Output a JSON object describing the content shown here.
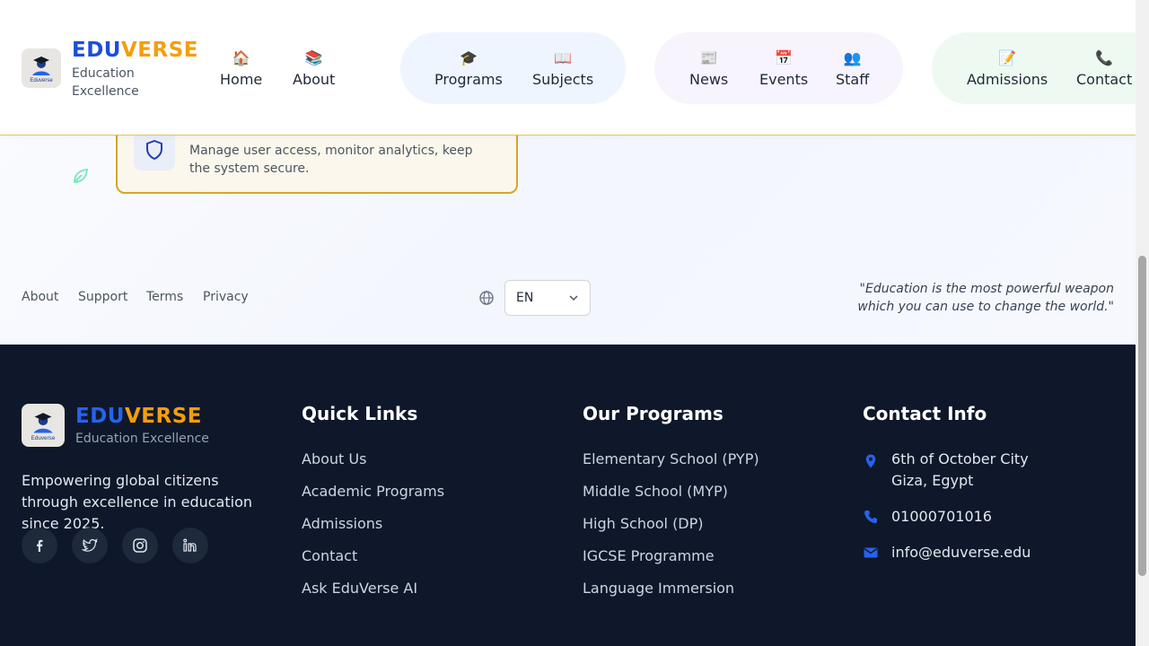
{
  "header": {
    "brand_part1": "EDU",
    "brand_part2": "VERSE",
    "logo_text": "Eduverse",
    "tagline": "Education Excellence",
    "nav": [
      {
        "icon": "🏠",
        "label": "Home"
      },
      {
        "icon": "📚",
        "label": "About"
      },
      {
        "icon": "🎓",
        "label": "Programs"
      },
      {
        "icon": "📖",
        "label": "Subjects"
      },
      {
        "icon": "📰",
        "label": "News"
      },
      {
        "icon": "📅",
        "label": "Events"
      },
      {
        "icon": "👥",
        "label": "Staff"
      },
      {
        "icon": "📝",
        "label": "Admissions"
      },
      {
        "icon": "📞",
        "label": "Contact"
      }
    ]
  },
  "card": {
    "icon": "shield-icon",
    "text": "Manage user access, monitor analytics, keep the system secure."
  },
  "footer_strip": {
    "links": [
      "About",
      "Support",
      "Terms",
      "Privacy"
    ],
    "language": "EN",
    "quote": "\"Education is the most powerful weapon which you can use to change the world.\""
  },
  "footer": {
    "brand_part1": "EDU",
    "brand_part2": "VERSE",
    "logo_text": "Eduverse",
    "tagline": "Education Excellence",
    "description": "Empowering global citizens through excellence in education since 2025.",
    "social": [
      "facebook-icon",
      "twitter-icon",
      "instagram-icon",
      "linkedin-icon"
    ],
    "quick_links_title": "Quick Links",
    "quick_links": [
      "About Us",
      "Academic Programs",
      "Admissions",
      "Contact",
      "Ask EduVerse AI"
    ],
    "programs_title": "Our Programs",
    "programs": [
      "Elementary School (PYP)",
      "Middle School (MYP)",
      "High School (DP)",
      "IGCSE Programme",
      "Language Immersion"
    ],
    "contact_title": "Contact Info",
    "address_line1": "6th of October City",
    "address_line2": "Giza, Egypt",
    "phone": "01000701016",
    "email": "info@eduverse.edu"
  },
  "colors": {
    "brand_blue": "#1d4ed8",
    "brand_gold": "#f59e0b",
    "footer_bg": "#0f172a",
    "contact_icon": "#2563eb"
  }
}
